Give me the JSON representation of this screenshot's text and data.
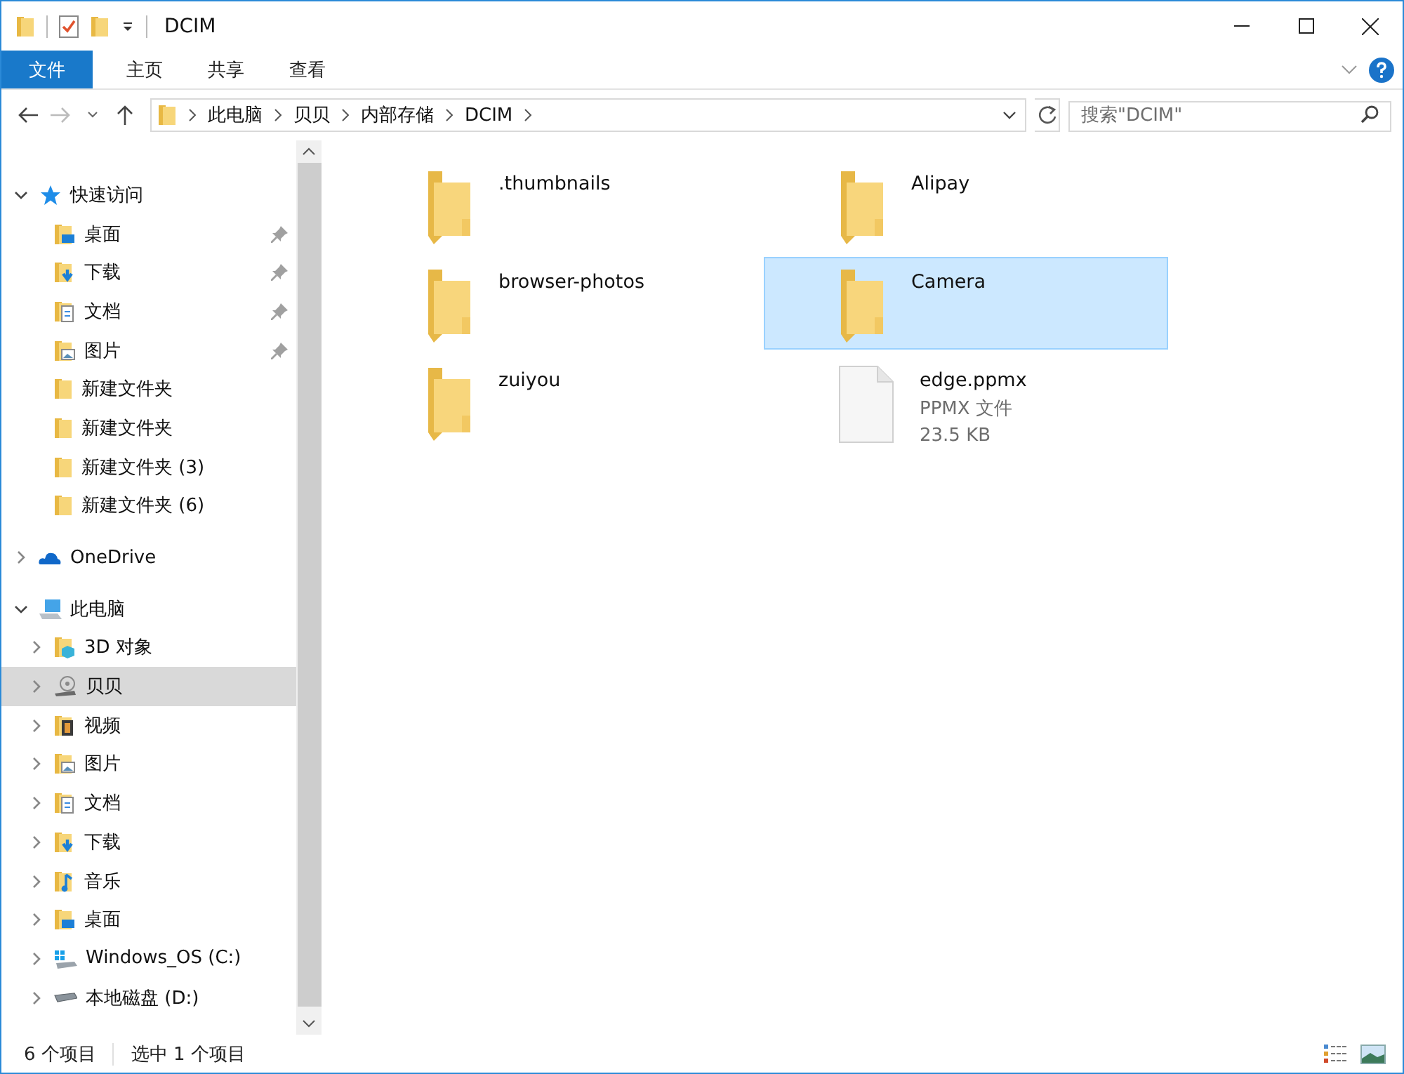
{
  "window": {
    "title": "DCIM"
  },
  "ribbon": {
    "tabs": [
      {
        "label": "文件",
        "kind": "file"
      },
      {
        "label": "主页",
        "kind": "tab"
      },
      {
        "label": "共享",
        "kind": "tab"
      },
      {
        "label": "查看",
        "kind": "tab"
      }
    ]
  },
  "address": {
    "path": [
      "此电脑",
      "贝贝",
      "内部存储",
      "DCIM"
    ]
  },
  "search": {
    "placeholder": "搜索\"DCIM\""
  },
  "sidebar": {
    "groups": [
      {
        "label": "快速访问",
        "kind": "star",
        "expanded": true,
        "selected": false,
        "children": [
          {
            "label": "桌面",
            "kind": "desktop",
            "pinned": true,
            "selected": false
          },
          {
            "label": "下载",
            "kind": "download",
            "pinned": true,
            "selected": false
          },
          {
            "label": "文档",
            "kind": "document",
            "pinned": true,
            "selected": false
          },
          {
            "label": "图片",
            "kind": "pictures",
            "pinned": true,
            "selected": false
          },
          {
            "label": "新建文件夹",
            "kind": "folder",
            "pinned": false,
            "selected": false
          },
          {
            "label": "新建文件夹",
            "kind": "folder",
            "pinned": false,
            "selected": false
          },
          {
            "label": "新建文件夹 (3)",
            "kind": "folder",
            "pinned": false,
            "selected": false
          },
          {
            "label": "新建文件夹 (6)",
            "kind": "folder",
            "pinned": false,
            "selected": false
          }
        ]
      },
      {
        "label": "OneDrive",
        "kind": "cloud",
        "expanded": false,
        "selected": false
      },
      {
        "label": "此电脑",
        "kind": "pc",
        "expanded": true,
        "selected": false,
        "children": [
          {
            "label": "3D 对象",
            "kind": "cube",
            "expanded": false,
            "selected": false
          },
          {
            "label": "贝贝",
            "kind": "phone",
            "expanded": false,
            "selected": true
          },
          {
            "label": "视频",
            "kind": "video",
            "expanded": false,
            "selected": false
          },
          {
            "label": "图片",
            "kind": "pictures",
            "expanded": false,
            "selected": false
          },
          {
            "label": "文档",
            "kind": "document",
            "expanded": false,
            "selected": false
          },
          {
            "label": "下载",
            "kind": "download",
            "expanded": false,
            "selected": false
          },
          {
            "label": "音乐",
            "kind": "music",
            "expanded": false,
            "selected": false
          },
          {
            "label": "桌面",
            "kind": "desktop",
            "expanded": false,
            "selected": false
          },
          {
            "label": "Windows_OS (C:)",
            "kind": "windrive",
            "expanded": false,
            "selected": false
          },
          {
            "label": "本地磁盘 (D:)",
            "kind": "drive",
            "expanded": false,
            "selected": false
          }
        ]
      }
    ]
  },
  "files": [
    {
      "name": ".thumbnails",
      "kind": "folder",
      "selected": false
    },
    {
      "name": "Alipay",
      "kind": "folder",
      "selected": false
    },
    {
      "name": "browser-photos",
      "kind": "folder",
      "selected": false
    },
    {
      "name": "Camera",
      "kind": "folder",
      "selected": true
    },
    {
      "name": "zuiyou",
      "kind": "folder",
      "selected": false
    },
    {
      "name": "edge.ppmx",
      "kind": "file",
      "type": "PPMX 文件",
      "size": "23.5 KB",
      "selected": false
    }
  ],
  "status_bar": {
    "count": "6 个项目",
    "selection": "选中 1 个项目"
  }
}
